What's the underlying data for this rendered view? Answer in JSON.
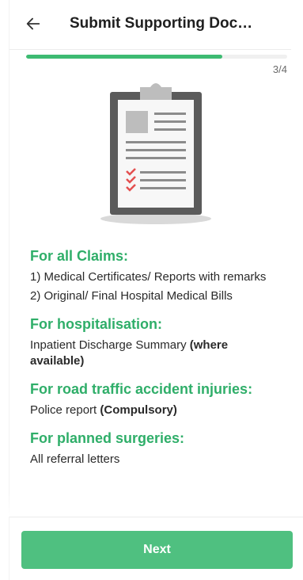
{
  "header": {
    "back_icon": "arrow-left-icon",
    "title": "Submit Supporting Doc…"
  },
  "progress": {
    "text": "3/4",
    "fraction": 0.75,
    "color": "#3dbb72"
  },
  "illustration": {
    "icon": "clipboard-checklist-icon"
  },
  "sections": [
    {
      "heading": "For all Claims:",
      "lines": [
        {
          "text": "1) Medical Certificates/ Reports with remarks",
          "bold": ""
        },
        {
          "text": "2) Original/ Final Hospital Medical Bills",
          "bold": ""
        }
      ]
    },
    {
      "heading": "For hospitalisation:",
      "lines": [
        {
          "text": "Inpatient Discharge Summary ",
          "bold": "(where available)"
        }
      ]
    },
    {
      "heading": "For road traffic accident injuries:",
      "lines": [
        {
          "text": "Police report ",
          "bold": "(Compulsory)"
        }
      ]
    },
    {
      "heading": "For planned surgeries:",
      "lines": [
        {
          "text": "All referral letters",
          "bold": ""
        }
      ]
    }
  ],
  "footer": {
    "next_label": "Next",
    "button_color": "#4fc080"
  },
  "colors": {
    "heading_green": "#2fae69",
    "text": "#2a2a2a"
  }
}
